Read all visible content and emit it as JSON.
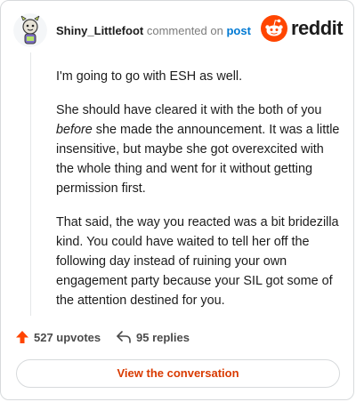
{
  "header": {
    "username": "Shiny_Littlefoot",
    "action_text": "commented on",
    "post_link": "post",
    "brand": "reddit"
  },
  "comment": {
    "paragraphs": {
      "p1": "I'm going to go with ESH as well.",
      "p2_a": "She should have cleared it with the both of you ",
      "p2_em": "before",
      "p2_b": " she made the announcement. It was a little insensitive, but maybe she got overexcited with the whole thing and went for it without getting permission first.",
      "p3": "That said, the way you reacted was a bit bridezilla kind. You could have waited to tell her off the following day instead of ruining your own engagement party because your SIL got some of the attention destined for you."
    }
  },
  "stats": {
    "upvotes": "527 upvotes",
    "replies": "95 replies"
  },
  "cta": {
    "label": "View the conversation"
  },
  "colors": {
    "upvote": "#ff4500",
    "link": "#0079d3",
    "cta_text": "#d93a00",
    "border": "#d7dadc"
  },
  "icons": {
    "avatar": "snoo-avatar",
    "brand_logo": "reddit-logo-icon",
    "upvote": "upvote-arrow-icon",
    "reply": "reply-arrow-icon"
  }
}
